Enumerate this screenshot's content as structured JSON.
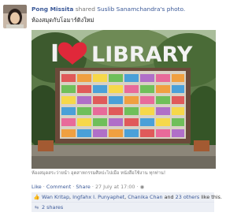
{
  "post": {
    "author": "Pong Missita",
    "verb": "shared",
    "source_author": "Suslib Sanamchandra's",
    "source_object": "photo.",
    "caption": "ห้องสมุดกับโอมาร์ติงใหม่",
    "photo_sign": "LIBRARY",
    "photo_caption": "ห้องสมุดสระว่ายน้ำ อุตสาหกรรมศิลปะไปเมื่อ หนังสือใช้งาน ทุกท่าน!",
    "actions": {
      "like": "Like",
      "comment": "Comment",
      "share": "Share",
      "timestamp": "27 July at 17:00",
      "sep": "·"
    },
    "likes": {
      "names": [
        "Wan Kritap",
        "Ingfahx I. Punyaphet",
        "Chanika Chan"
      ],
      "and": "and",
      "others_link": "23 others",
      "suffix": "like this."
    },
    "shares": {
      "label": "2 shares"
    }
  },
  "colors": {
    "link": "#3b5998",
    "likes_bg": "#eceff5"
  }
}
